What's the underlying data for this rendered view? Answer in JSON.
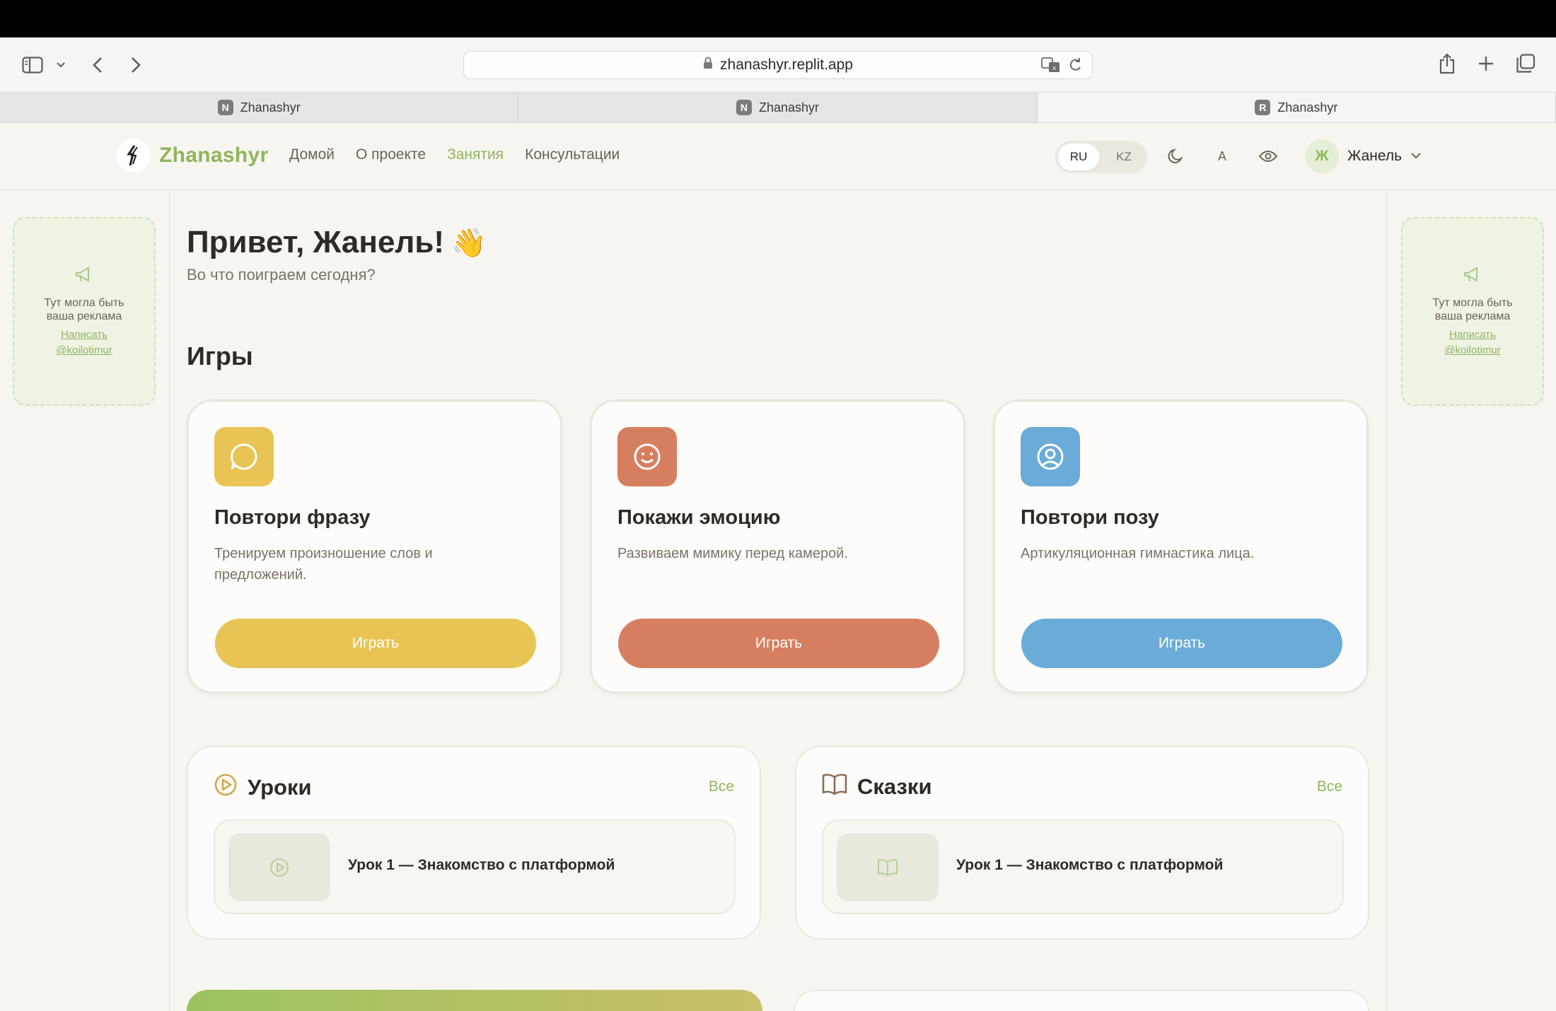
{
  "browser": {
    "url": "zhanashyr.replit.app",
    "tabs": [
      {
        "favicon": "N",
        "title": "Zhanashyr"
      },
      {
        "favicon": "N",
        "title": "Zhanashyr"
      },
      {
        "favicon": "R",
        "title": "Zhanashyr"
      }
    ]
  },
  "header": {
    "logo_text": "Zhanashyr",
    "nav": [
      "Домой",
      "О проекте",
      "Занятия",
      "Консультации"
    ],
    "active_nav": "Занятия",
    "lang": {
      "ru": "RU",
      "kz": "KZ",
      "selected": "RU"
    },
    "font_size_label": "A",
    "user": {
      "initial": "Ж",
      "name": "Жанель"
    }
  },
  "ad": {
    "text": "Тут могла быть ваша реклама",
    "link": "Написать",
    "handle": "@koilotimur"
  },
  "main": {
    "greeting": "Привет, Жанель!",
    "greeting_emoji": "👋",
    "subtitle": "Во что поиграем сегодня?",
    "games_title": "Игры",
    "games": [
      {
        "title": "Повтори фразу",
        "desc": "Тренируем произношение слов и предложений.",
        "button": "Играть",
        "color": "#e8c455",
        "icon": "chat-bubble-icon"
      },
      {
        "title": "Покажи эмоцию",
        "desc": "Развиваем мимику перед камерой.",
        "button": "Играть",
        "color": "#d67f60",
        "icon": "smile-icon"
      },
      {
        "title": "Повтори позу",
        "desc": "Артикуляционная гимнастика лица.",
        "button": "Играть",
        "color": "#6aacd7",
        "icon": "user-circle-icon"
      }
    ],
    "lessons": {
      "title": "Уроки",
      "see_all": "Все",
      "item": "Урок 1 — Знакомство с платформой"
    },
    "tales": {
      "title": "Сказки",
      "see_all": "Все",
      "item": "Урок 1 — Знакомство с платформой"
    }
  },
  "colors": {
    "accent": "#8fb55c",
    "background": "#f7f5ef"
  }
}
